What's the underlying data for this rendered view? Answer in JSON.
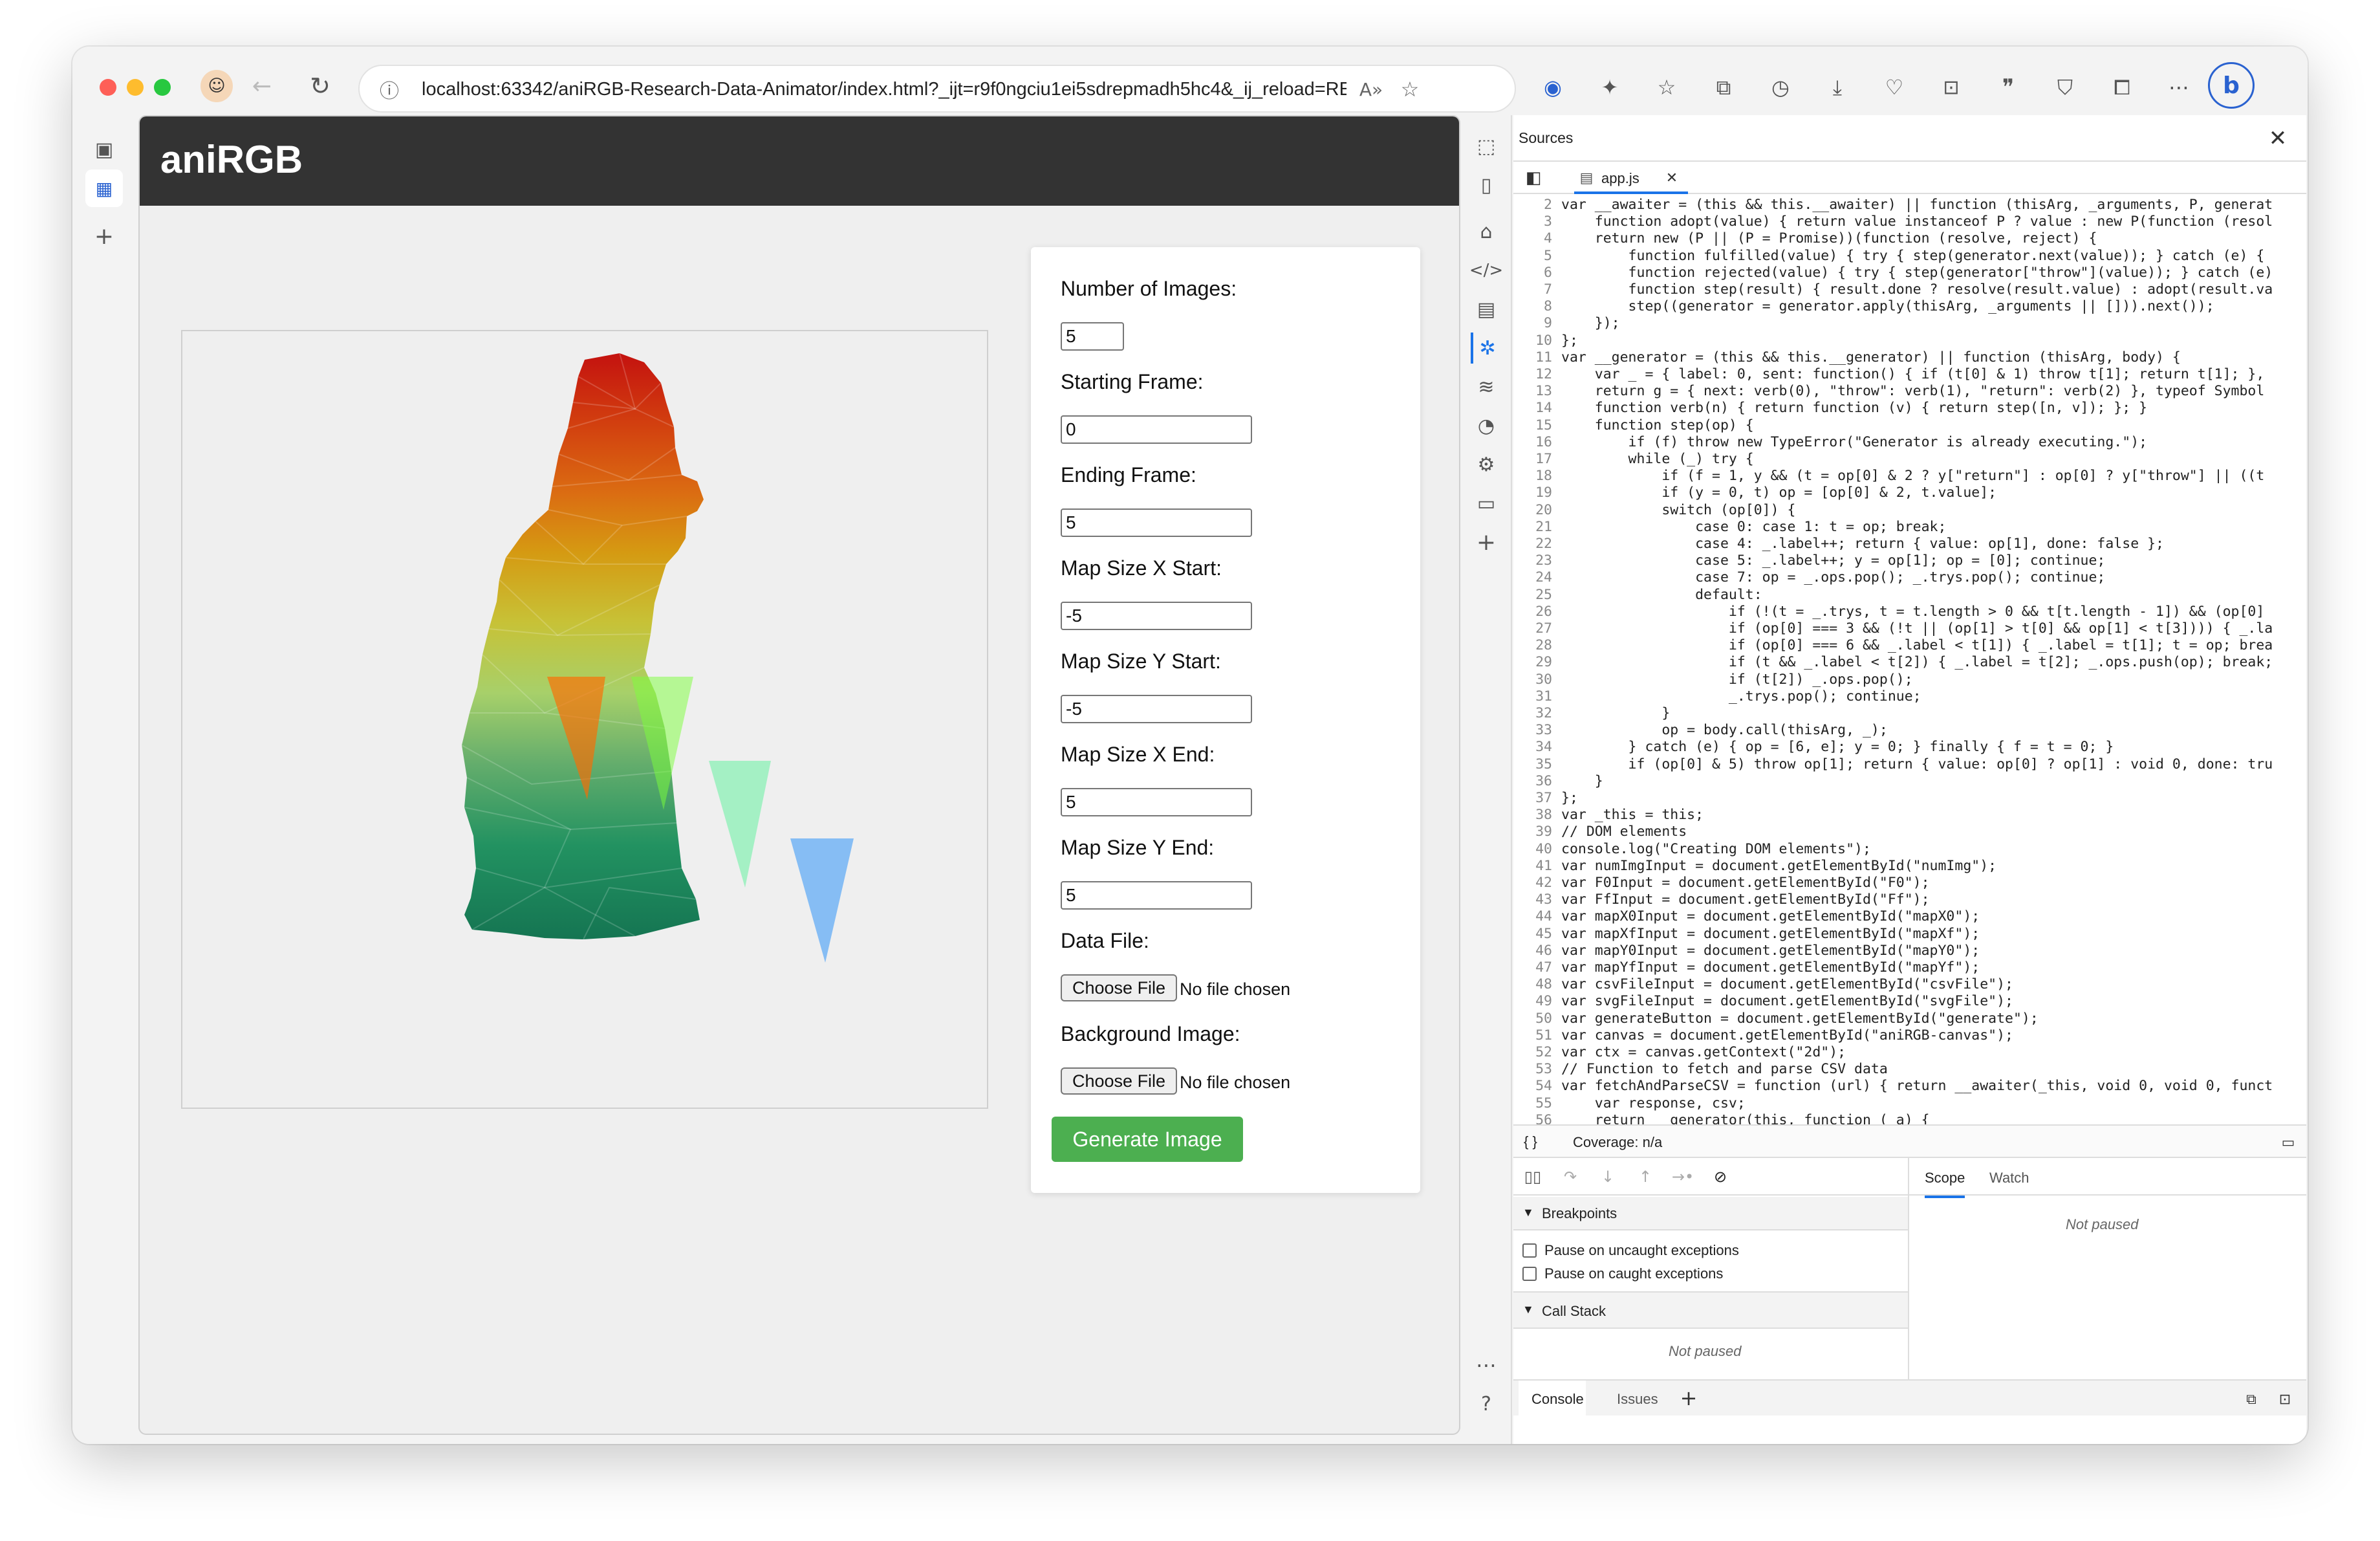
{
  "browser": {
    "url": "localhost:63342/aniRGB-Research-Data-Animator/index.html?_ijt=r9f0ngciu1ei5sdrepmadh5hc4&_ij_reload=RE..."
  },
  "app": {
    "title": "aniRGB",
    "form": {
      "num_images_label": "Number of Images:",
      "num_images_value": "5",
      "start_frame_label": "Starting Frame:",
      "start_frame_value": "0",
      "end_frame_label": "Ending Frame:",
      "end_frame_value": "5",
      "map_x_start_label": "Map Size X Start:",
      "map_x_start_value": "-5",
      "map_y_start_label": "Map Size Y Start:",
      "map_y_start_value": "-5",
      "map_x_end_label": "Map Size X End:",
      "map_x_end_value": "5",
      "map_y_end_label": "Map Size Y End:",
      "map_y_end_value": "5",
      "data_file_label": "Data File:",
      "bg_image_label": "Background Image:",
      "choose_file": "Choose File",
      "no_file": "No file chosen",
      "generate": "Generate Image"
    }
  },
  "devtools": {
    "panel_title": "Sources",
    "file_tab": "app.js",
    "coverage": "Coverage: n/a",
    "scope_tab": "Scope",
    "watch_tab": "Watch",
    "not_paused": "Not paused",
    "breakpoints": "Breakpoints",
    "pause_uncaught": "Pause on uncaught exceptions",
    "pause_caught": "Pause on caught exceptions",
    "call_stack": "Call Stack",
    "console_tab": "Console",
    "issues_tab": "Issues",
    "code_lines": [
      {
        "n": "2",
        "t": "var __awaiter = (this && this.__awaiter) || function (thisArg, _arguments, P, generat"
      },
      {
        "n": "3",
        "t": "    function adopt(value) { return value instanceof P ? value : new P(function (resol"
      },
      {
        "n": "4",
        "t": "    return new (P || (P = Promise))(function (resolve, reject) {"
      },
      {
        "n": "5",
        "t": "        function fulfilled(value) { try { step(generator.next(value)); } catch (e) {"
      },
      {
        "n": "6",
        "t": "        function rejected(value) { try { step(generator[\"throw\"](value)); } catch (e)"
      },
      {
        "n": "7",
        "t": "        function step(result) { result.done ? resolve(result.value) : adopt(result.va"
      },
      {
        "n": "8",
        "t": "        step((generator = generator.apply(thisArg, _arguments || [])).next());"
      },
      {
        "n": "9",
        "t": "    });"
      },
      {
        "n": "10",
        "t": "};"
      },
      {
        "n": "11",
        "t": "var __generator = (this && this.__generator) || function (thisArg, body) {"
      },
      {
        "n": "12",
        "t": "    var _ = { label: 0, sent: function() { if (t[0] & 1) throw t[1]; return t[1]; },"
      },
      {
        "n": "13",
        "t": "    return g = { next: verb(0), \"throw\": verb(1), \"return\": verb(2) }, typeof Symbol"
      },
      {
        "n": "14",
        "t": "    function verb(n) { return function (v) { return step([n, v]); }; }"
      },
      {
        "n": "15",
        "t": "    function step(op) {"
      },
      {
        "n": "16",
        "t": "        if (f) throw new TypeError(\"Generator is already executing.\");"
      },
      {
        "n": "17",
        "t": "        while (_) try {"
      },
      {
        "n": "18",
        "t": "            if (f = 1, y && (t = op[0] & 2 ? y[\"return\"] : op[0] ? y[\"throw\"] || ((t"
      },
      {
        "n": "19",
        "t": "            if (y = 0, t) op = [op[0] & 2, t.value];"
      },
      {
        "n": "20",
        "t": "            switch (op[0]) {"
      },
      {
        "n": "21",
        "t": "                case 0: case 1: t = op; break;"
      },
      {
        "n": "22",
        "t": "                case 4: _.label++; return { value: op[1], done: false };"
      },
      {
        "n": "23",
        "t": "                case 5: _.label++; y = op[1]; op = [0]; continue;"
      },
      {
        "n": "24",
        "t": "                case 7: op = _.ops.pop(); _.trys.pop(); continue;"
      },
      {
        "n": "25",
        "t": "                default:"
      },
      {
        "n": "26",
        "t": "                    if (!(t = _.trys, t = t.length > 0 && t[t.length - 1]) && (op[0]"
      },
      {
        "n": "27",
        "t": "                    if (op[0] === 3 && (!t || (op[1] > t[0] && op[1] < t[3]))) { _.la"
      },
      {
        "n": "28",
        "t": "                    if (op[0] === 6 && _.label < t[1]) { _.label = t[1]; t = op; brea"
      },
      {
        "n": "29",
        "t": "                    if (t && _.label < t[2]) { _.label = t[2]; _.ops.push(op); break;"
      },
      {
        "n": "30",
        "t": "                    if (t[2]) _.ops.pop();"
      },
      {
        "n": "31",
        "t": "                    _.trys.pop(); continue;"
      },
      {
        "n": "32",
        "t": "            }"
      },
      {
        "n": "33",
        "t": "            op = body.call(thisArg, _);"
      },
      {
        "n": "34",
        "t": "        } catch (e) { op = [6, e]; y = 0; } finally { f = t = 0; }"
      },
      {
        "n": "35",
        "t": "        if (op[0] & 5) throw op[1]; return { value: op[0] ? op[1] : void 0, done: tru"
      },
      {
        "n": "36",
        "t": "    }"
      },
      {
        "n": "37",
        "t": "};"
      },
      {
        "n": "38",
        "t": "var _this = this;"
      },
      {
        "n": "39",
        "t": "// DOM elements"
      },
      {
        "n": "40",
        "t": "console.log(\"Creating DOM elements\");"
      },
      {
        "n": "41",
        "t": "var numImgInput = document.getElementById(\"numImg\");"
      },
      {
        "n": "42",
        "t": "var F0Input = document.getElementById(\"F0\");"
      },
      {
        "n": "43",
        "t": "var FfInput = document.getElementById(\"Ff\");"
      },
      {
        "n": "44",
        "t": "var mapX0Input = document.getElementById(\"mapX0\");"
      },
      {
        "n": "45",
        "t": "var mapXfInput = document.getElementById(\"mapXf\");"
      },
      {
        "n": "46",
        "t": "var mapY0Input = document.getElementById(\"mapY0\");"
      },
      {
        "n": "47",
        "t": "var mapYfInput = document.getElementById(\"mapYf\");"
      },
      {
        "n": "48",
        "t": "var csvFileInput = document.getElementById(\"csvFile\");"
      },
      {
        "n": "49",
        "t": "var svgFileInput = document.getElementById(\"svgFile\");"
      },
      {
        "n": "50",
        "t": "var generateButton = document.getElementById(\"generate\");"
      },
      {
        "n": "51",
        "t": "var canvas = document.getElementById(\"aniRGB-canvas\");"
      },
      {
        "n": "52",
        "t": "var ctx = canvas.getContext(\"2d\");"
      },
      {
        "n": "53",
        "t": "// Function to fetch and parse CSV data"
      },
      {
        "n": "54",
        "t": "var fetchAndParseCSV = function (url) { return __awaiter(_this, void 0, void 0, funct"
      },
      {
        "n": "55",
        "t": "    var response, csv;"
      },
      {
        "n": "56",
        "t": "    return __generator(this, function (_a) {"
      }
    ]
  }
}
